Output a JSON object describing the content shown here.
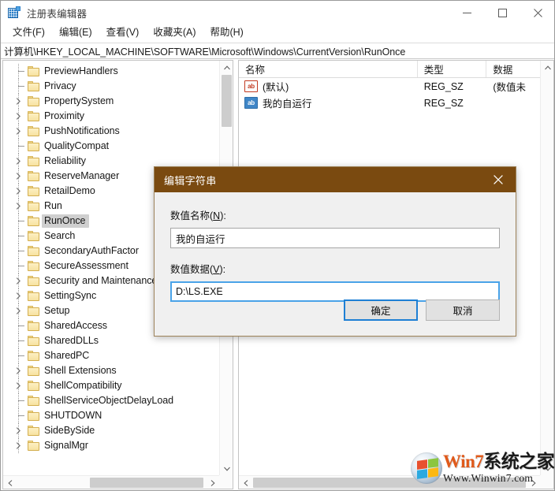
{
  "window": {
    "title": "注册表编辑器",
    "icon": "registry-editor-icon",
    "minimize_label": "最小化",
    "maximize_label": "最大化",
    "close_label": "关闭"
  },
  "menubar": {
    "items": [
      {
        "label": "文件(F)",
        "name": "menu-file"
      },
      {
        "label": "编辑(E)",
        "name": "menu-edit"
      },
      {
        "label": "查看(V)",
        "name": "menu-view"
      },
      {
        "label": "收藏夹(A)",
        "name": "menu-favorites"
      },
      {
        "label": "帮助(H)",
        "name": "menu-help"
      }
    ]
  },
  "address": {
    "path": "计算机\\HKEY_LOCAL_MACHINE\\SOFTWARE\\Microsoft\\Windows\\CurrentVersion\\RunOnce"
  },
  "tree": {
    "items": [
      {
        "label": "PreviewHandlers",
        "expandable": false,
        "selected": false
      },
      {
        "label": "Privacy",
        "expandable": false,
        "selected": false
      },
      {
        "label": "PropertySystem",
        "expandable": true,
        "selected": false
      },
      {
        "label": "Proximity",
        "expandable": true,
        "selected": false
      },
      {
        "label": "PushNotifications",
        "expandable": true,
        "selected": false
      },
      {
        "label": "QualityCompat",
        "expandable": false,
        "selected": false
      },
      {
        "label": "Reliability",
        "expandable": true,
        "selected": false
      },
      {
        "label": "ReserveManager",
        "expandable": true,
        "selected": false
      },
      {
        "label": "RetailDemo",
        "expandable": true,
        "selected": false
      },
      {
        "label": "Run",
        "expandable": true,
        "selected": false
      },
      {
        "label": "RunOnce",
        "expandable": false,
        "selected": true
      },
      {
        "label": "Search",
        "expandable": false,
        "selected": false
      },
      {
        "label": "SecondaryAuthFactor",
        "expandable": false,
        "selected": false
      },
      {
        "label": "SecureAssessment",
        "expandable": false,
        "selected": false
      },
      {
        "label": "Security and Maintenance",
        "expandable": true,
        "selected": false
      },
      {
        "label": "SettingSync",
        "expandable": true,
        "selected": false
      },
      {
        "label": "Setup",
        "expandable": true,
        "selected": false
      },
      {
        "label": "SharedAccess",
        "expandable": false,
        "selected": false
      },
      {
        "label": "SharedDLLs",
        "expandable": false,
        "selected": false
      },
      {
        "label": "SharedPC",
        "expandable": false,
        "selected": false
      },
      {
        "label": "Shell Extensions",
        "expandable": true,
        "selected": false
      },
      {
        "label": "ShellCompatibility",
        "expandable": true,
        "selected": false
      },
      {
        "label": "ShellServiceObjectDelayLoad",
        "expandable": false,
        "selected": false
      },
      {
        "label": "SHUTDOWN",
        "expandable": false,
        "selected": false
      },
      {
        "label": "SideBySide",
        "expandable": true,
        "selected": false
      },
      {
        "label": "SignalMgr",
        "expandable": true,
        "selected": false
      }
    ]
  },
  "list": {
    "columns": [
      {
        "label": "名称",
        "name": "column-name"
      },
      {
        "label": "类型",
        "name": "column-type"
      },
      {
        "label": "数据",
        "name": "column-data"
      }
    ],
    "rows": [
      {
        "name": "(默认)",
        "type": "REG_SZ",
        "data": "(数值未",
        "icon": "string-value-default-icon"
      },
      {
        "name": "我的自运行",
        "type": "REG_SZ",
        "data": "",
        "icon": "string-value-icon"
      }
    ]
  },
  "dialog": {
    "title": "编辑字符串",
    "close_label": "关闭",
    "name_label_pre": "数值名称(",
    "name_label_key": "N",
    "name_label_post": "):",
    "name_value": "我的自运行",
    "name_placeholder": "",
    "data_label_pre": "数值数据(",
    "data_label_key": "V",
    "data_label_post": "):",
    "data_value": "D:\\LS.EXE",
    "data_placeholder": "",
    "ok_label": "确定",
    "cancel_label": "取消",
    "titlebar_color": "#7a4a10",
    "focus_color": "#1e7fd4"
  },
  "watermark": {
    "brand_en": "Win7",
    "brand_cn": "系统之家",
    "site": "Www.Winwin7.com"
  }
}
